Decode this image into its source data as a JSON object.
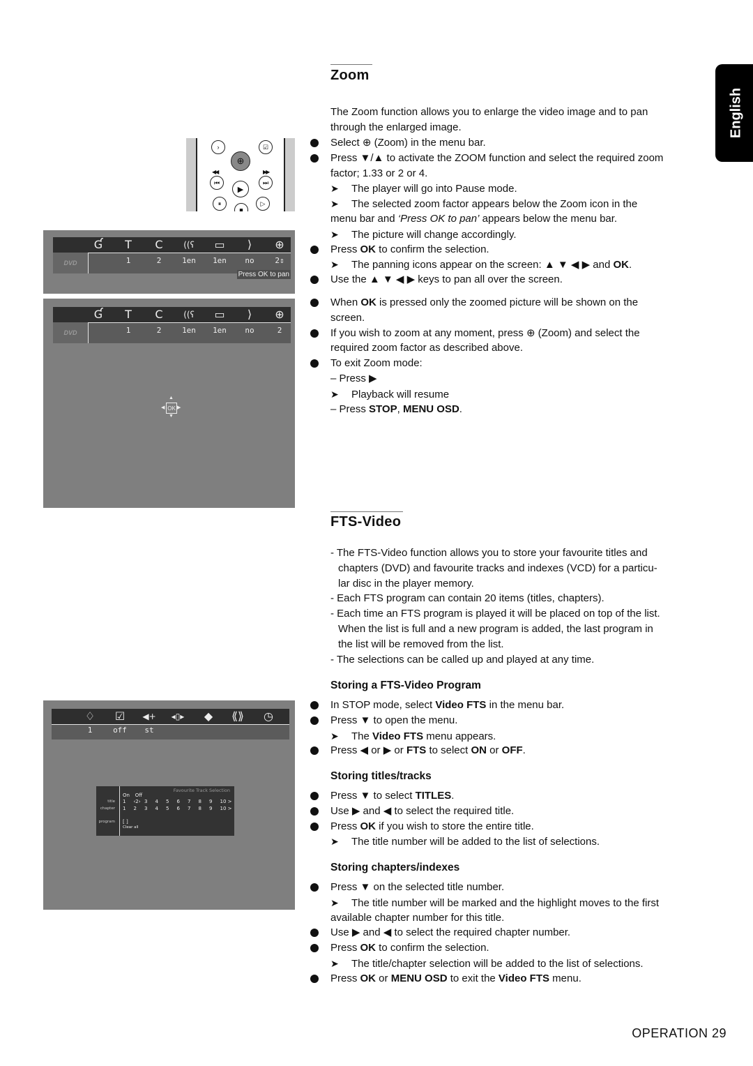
{
  "lang_tab": "English",
  "zoom_section": {
    "heading": "Zoom",
    "intro": [
      "The Zoom function allows you to enlarge the video image and to pan",
      "through the enlarged image."
    ],
    "lines": [
      {
        "type": "bullet",
        "text": "Select ⊕ (Zoom) in the menu bar."
      },
      {
        "type": "bullet",
        "text": "Press ▼/▲ to activate the ZOOM function and select the required zoom"
      },
      {
        "type": "cont",
        "text": "factor; 1.33 or 2 or 4."
      },
      {
        "type": "arrow",
        "text": "The player will go into Pause mode."
      },
      {
        "type": "arrow",
        "text": "The selected zoom factor appears below the Zoom icon in the"
      },
      {
        "type": "cont",
        "text": "menu bar and ‘Press OK to pan’ appears below the menu bar."
      },
      {
        "type": "arrow",
        "text": "The picture will change accordingly."
      },
      {
        "type": "bullet",
        "text": "Press OK to confirm the selection."
      },
      {
        "type": "arrow",
        "text": "The panning icons appear on the screen: ▲ ▼ ◀ ▶ and OK."
      },
      {
        "type": "bullet",
        "text": "Use the ▲ ▼ ◀ ▶ keys to pan all over the screen."
      },
      {
        "type": "bullet",
        "text": "When OK is pressed only the zoomed picture will be shown on the"
      },
      {
        "type": "cont",
        "text": "screen."
      },
      {
        "type": "bullet",
        "text": "If you wish to zoom at any moment, press ⊕ (Zoom) and select the"
      },
      {
        "type": "cont",
        "text": "required zoom factor as described above."
      },
      {
        "type": "bullet",
        "text": "To exit Zoom mode:"
      },
      {
        "type": "cont",
        "text": "– Press ▶"
      },
      {
        "type": "arrow",
        "text": "Playback will resume"
      },
      {
        "type": "cont",
        "text": "– Press STOP, MENU OSD."
      }
    ]
  },
  "fts_section": {
    "heading": "FTS-Video",
    "intro": [
      "- The FTS-Video function allows you to store your favourite titles and",
      "chapters (DVD) and favourite tracks and indexes (VCD) for a particu-",
      "lar disc in the player memory.",
      "- Each FTS program can contain 20 items (titles, chapters).",
      "- Each time an FTS program is played it will be placed on top of the list.",
      "When the list is full and a new program is added, the last program in",
      "the list will be removed from the list.",
      "- The selections can be called up and played at any time."
    ],
    "sub1": {
      "heading": "Storing a FTS-Video Program",
      "lines": [
        {
          "type": "bullet",
          "text": "In STOP mode, select Video FTS in the menu bar."
        },
        {
          "type": "bullet",
          "text": "Press ▼ to open the menu."
        },
        {
          "type": "arrow",
          "text": "The Video FTS menu appears."
        },
        {
          "type": "bullet",
          "text": "Press ◀ or ▶ or FTS to select ON or OFF."
        }
      ]
    },
    "sub2": {
      "heading": "Storing titles/tracks",
      "lines": [
        {
          "type": "bullet",
          "text": "Press ▼ to select TITLES."
        },
        {
          "type": "bullet",
          "text": "Use ▶ and ◀ to select the required title."
        },
        {
          "type": "bullet",
          "text": "Press OK if you wish to store the entire title."
        },
        {
          "type": "arrow",
          "text": "The title number will be added to the list of selections."
        }
      ]
    },
    "sub3": {
      "heading": "Storing chapters/indexes",
      "lines": [
        {
          "type": "bullet",
          "text": "Press ▼ on the selected title number."
        },
        {
          "type": "arrow",
          "text": "The title number will be marked and the highlight moves to the first"
        },
        {
          "type": "cont",
          "text": "available chapter number for this title."
        },
        {
          "type": "bullet",
          "text": "Use ▶ and ◀ to select the required chapter number."
        },
        {
          "type": "bullet",
          "text": "Press OK to confirm the selection."
        },
        {
          "type": "arrow",
          "text": "The title/chapter selection will be added to the list of selections."
        },
        {
          "type": "bullet",
          "text": "Press OK or MENU OSD to exit the Video FTS menu."
        }
      ]
    }
  },
  "remote": {
    "buttons": [
      "angle",
      "fts",
      "zoom",
      "previous",
      "play",
      "next",
      "pause",
      "stop",
      "step"
    ],
    "rewind_label": "◀◀",
    "forward_label": "▶▶"
  },
  "screen1": {
    "icons": [
      "user-prefs-icon",
      "title-icon",
      "chapter-icon",
      "audio-icon",
      "subtitle-icon",
      "angle-icon",
      "zoom-icon"
    ],
    "glyphs": [
      "Ɠ",
      "T",
      "C",
      "((ʕ",
      "▭",
      "⟩",
      "⊕"
    ],
    "values": [
      "1",
      "2",
      "1en",
      "1en",
      "no",
      "2⇕"
    ],
    "dvd_logo": "DVD",
    "hint": "Press OK to pan"
  },
  "screen2": {
    "glyphs": [
      "Ɠ",
      "T",
      "C",
      "((ʕ",
      "▭",
      "⟩",
      "⊕"
    ],
    "values": [
      "1",
      "2",
      "1en",
      "1en",
      "no",
      "2"
    ],
    "dvd_logo": "DVD",
    "ok_label": "OK"
  },
  "screen3": {
    "glyphs": [
      "♢",
      "☑",
      "◀+",
      "◂▯▸",
      "◆",
      "⟪⟫",
      "◷"
    ],
    "values": [
      "1",
      "off",
      "st"
    ],
    "fav": {
      "title": "Favourite Track Selection",
      "on": "On",
      "off": "Off",
      "labels": [
        "title",
        "chapter",
        "program"
      ],
      "title_row": [
        "1",
        "‹2›",
        "3",
        "4",
        "5",
        "6",
        "7",
        "8",
        "9",
        "10 >"
      ],
      "chapter_row": [
        "1",
        "2",
        "3",
        "4",
        "5",
        "6",
        "7",
        "8",
        "9",
        "10 >"
      ],
      "program": "[ ]",
      "clear_all": "Clear all"
    }
  },
  "footer": "OPERATION 29"
}
